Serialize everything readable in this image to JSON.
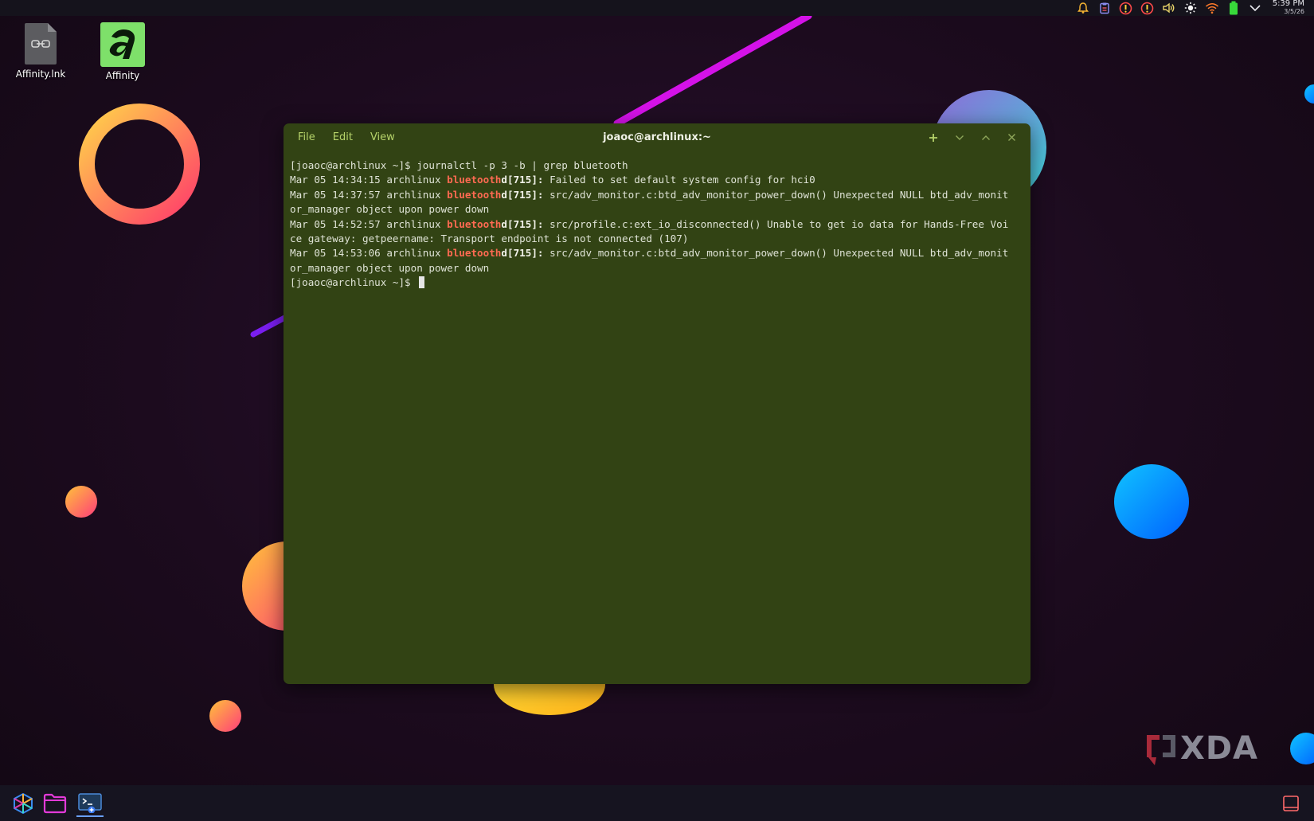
{
  "desktop": {
    "icons": [
      {
        "label": "Affinity.lnk",
        "icon": "shortcut-file-icon"
      },
      {
        "label": "Affinity",
        "icon": "affinity-app-icon",
        "color": "#7ee06a"
      }
    ]
  },
  "tray": {
    "icons": [
      "notification-bell-icon",
      "clipboard-icon",
      "update-alert-icon",
      "update-alert-icon-2",
      "volume-icon",
      "brightness-icon",
      "wifi-icon",
      "battery-icon",
      "expand-chevron-icon"
    ],
    "time": "5:39 PM",
    "date": "3/5/26"
  },
  "terminal": {
    "title": "joaoc@archlinux:~",
    "menu": [
      "File",
      "Edit",
      "View"
    ],
    "controls": [
      "new-tab-icon",
      "minimize-icon",
      "maximize-icon",
      "close-icon"
    ],
    "background": "#324314",
    "accent": "#b6d36a",
    "prompt_line": "[joaoc@archlinux ~]$ journalctl -p 3 -b | grep bluetooth",
    "logs": [
      {
        "prefix": "Mar 05 14:34:15 archlinux ",
        "match": "bluetooth",
        "rest": "d",
        "pid": "[715]:",
        "message": " Failed to set default system config for hci0"
      },
      {
        "prefix": "Mar 05 14:37:57 archlinux ",
        "match": "bluetooth",
        "rest": "d",
        "pid": "[715]:",
        "message": " src/adv_monitor.c:btd_adv_monitor_power_down() Unexpected NULL btd_adv_monit",
        "wrap": "or_manager object upon power down"
      },
      {
        "prefix": "Mar 05 14:52:57 archlinux ",
        "match": "bluetooth",
        "rest": "d",
        "pid": "[715]:",
        "message": " src/profile.c:ext_io_disconnected() Unable to get io data for Hands-Free Voi",
        "wrap": "ce gateway: getpeername: Transport endpoint is not connected (107)"
      },
      {
        "prefix": "Mar 05 14:53:06 archlinux ",
        "match": "bluetooth",
        "rest": "d",
        "pid": "[715]:",
        "message": " src/adv_monitor.c:btd_adv_monitor_power_down() Unexpected NULL btd_adv_monit",
        "wrap": "or_manager object upon power down"
      }
    ],
    "final_prompt": "[joaoc@archlinux ~]$ "
  },
  "taskbar": {
    "items": [
      "app-launcher-icon",
      "file-manager-icon",
      "terminal-app-icon"
    ],
    "right": "show-desktop-icon"
  },
  "watermark": {
    "text": "XDA"
  }
}
